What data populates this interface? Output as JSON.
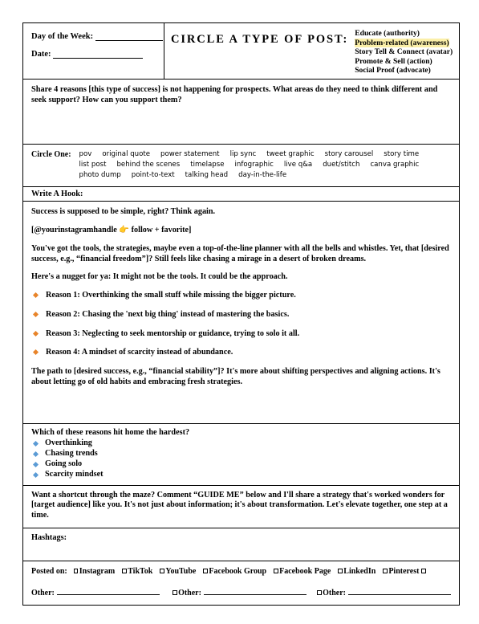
{
  "header": {
    "day_label": "Day of the Week:",
    "date_label": "Date:",
    "circle_title": "CIRCLE A TYPE OF POST:",
    "post_types": [
      {
        "label": "Educate (authority)",
        "highlighted": false
      },
      {
        "label": "Problem-related (awareness)",
        "highlighted": true
      },
      {
        "label": "Story Tell & Connect (avatar)",
        "highlighted": false
      },
      {
        "label": "Promote & Sell (action)",
        "highlighted": false
      },
      {
        "label": "Social Proof (advocate)",
        "highlighted": false
      }
    ],
    "highlight_color": "#fbefa8"
  },
  "prompt": {
    "text": "Share 4 reasons [this type of success] is not happening for prospects. What areas do they need to think different and seek support? How can you support them?"
  },
  "circle_one": {
    "label": "Circle One:",
    "rows": [
      [
        "pov",
        "original quote",
        "power statement",
        "lip sync",
        "tweet graphic",
        "story carousel",
        "story time"
      ],
      [
        "list post",
        "behind the scenes",
        "timelapse",
        "infographic",
        "live q&a",
        "duet/stitch",
        "canva graphic"
      ],
      [
        "photo dump",
        "point-to-text",
        "talking head",
        "day-in-the-life"
      ]
    ]
  },
  "hook": {
    "label": "Write A Hook:"
  },
  "body": {
    "hook_line": "Success is supposed to be simple, right? Think again.",
    "handle_prefix": "[@yourinstagramhandle ",
    "handle_emoji": "👉",
    "handle_suffix": " follow + favorite]",
    "paragraph1": "You've got the tools, the strategies, maybe even a top-of-the-line planner with all the bells and whistles. Yet, that [desired success, e.g., “financial freedom”]? Still feels like chasing a mirage in a desert of broken dreams.",
    "paragraph2": "Here's a nugget for ya: It might not be the tools. It could be the approach.",
    "reasons": [
      "Reason 1: Overthinking the small stuff while missing the bigger picture.",
      "Reason 2: Chasing the 'next big thing' instead of mastering the basics.",
      "Reason 3: Neglecting to seek mentorship or guidance, trying to solo it all.",
      "Reason 4: A mindset of scarcity instead of abundance."
    ],
    "reason_bullet_color": "#e8842a",
    "paragraph3": "The path to [desired success, e.g., “financial stability”]? It's more about shifting perspectives and aligning actions. It's about letting go of old habits and embracing fresh strategies."
  },
  "question": {
    "prompt": "Which of these reasons hit home the hardest?",
    "options": [
      "Overthinking",
      "Chasing trends",
      "Going solo",
      "Scarcity mindset"
    ],
    "bullet_color": "#5b9bd5"
  },
  "cta": {
    "text": "Want a shortcut through the maze? Comment “GUIDE ME” below and I'll share a strategy that's worked wonders for [target audience] like you. It's not just about information; it's about transformation. Let's elevate together, one step at a time."
  },
  "hashtags": {
    "label": "Hashtags:"
  },
  "posted": {
    "label": "Posted on:",
    "platforms": [
      "Instagram",
      "TikTok",
      "YouTube",
      "Facebook Group",
      "Facebook Page",
      "LinkedIn",
      "Pinterest"
    ],
    "other_label": "Other:"
  }
}
